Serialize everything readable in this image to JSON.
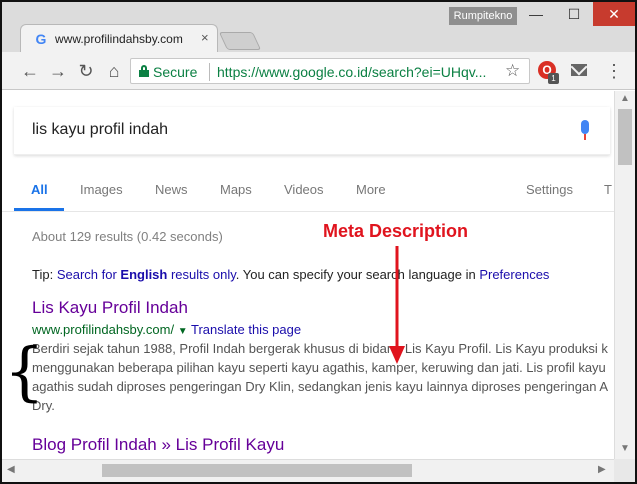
{
  "window": {
    "profile_name": "Rumpitekno",
    "minimize_glyph": "—",
    "maximize_glyph": "☐",
    "close_glyph": "✕"
  },
  "tab": {
    "favicon": "G",
    "title": "www.profilindahsby.com",
    "close_glyph": "×"
  },
  "toolbar": {
    "back_glyph": "←",
    "forward_glyph": "→",
    "reload_glyph": "↻",
    "home_glyph": "⌂",
    "secure_label": "Secure",
    "url": "https://www.google.co.id/search?ei=UHqv...",
    "star_glyph": "☆",
    "extension_glyph": "O",
    "extension_badge": "1",
    "menu_glyph": "⋮"
  },
  "search": {
    "query": "lis kayu profil indah"
  },
  "search_tabs": [
    {
      "label": "All",
      "active": true
    },
    {
      "label": "Images"
    },
    {
      "label": "News"
    },
    {
      "label": "Maps"
    },
    {
      "label": "Videos"
    },
    {
      "label": "More"
    },
    {
      "label": "Settings"
    },
    {
      "label": "T"
    }
  ],
  "results_stats": "About 129 results (0.42 seconds)",
  "tip": {
    "prefix": "Tip: ",
    "link1": "Search for ",
    "link1_bold": "English",
    "link1_suffix": " results only",
    "middle": ". You can specify your search language in ",
    "link2": "Preferences"
  },
  "results": [
    {
      "title": "Lis Kayu Profil Indah",
      "url": "www.profilindahsby.com/",
      "caret": "▼",
      "translate": "Translate this page",
      "snippet_lines": [
        "Berdiri sejak tahun 1988, Profil Indah bergerak khusus di bidang Lis Kayu Profil. Lis Kayu produksi k",
        "menggunakan beberapa pilihan kayu seperti kayu agathis, kamper, keruwing dan jati. Lis profil kayu",
        "agathis sudah diproses pengeringan Dry Klin, sedangkan jenis kayu lainnya diproses pengeringan A",
        "Dry."
      ]
    },
    {
      "title": "Blog Profil Indah » Lis Profil Kayu"
    }
  ],
  "annotation": {
    "label": "Meta Description",
    "color": "#e0141e",
    "brace_left": "{",
    "brace_right": "}"
  },
  "scroll": {
    "up": "▲",
    "down": "▼",
    "left": "◀",
    "right": "▶"
  }
}
